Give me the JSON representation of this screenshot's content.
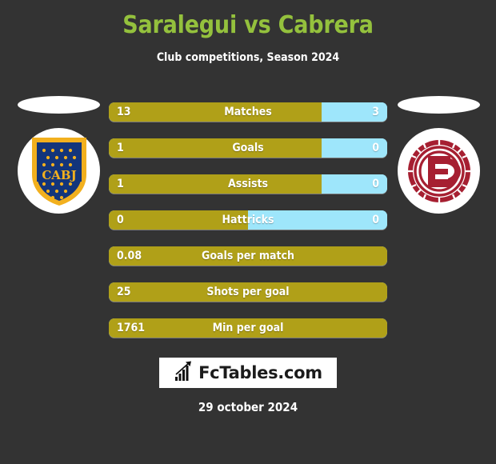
{
  "header": {
    "title": "Saralegui vs Cabrera",
    "subtitle": "Club competitions, Season 2024",
    "title_color": "#94c13d"
  },
  "teams": {
    "home": {
      "crest_name": "boca-juniors-crest",
      "crest_text": "CABJ"
    },
    "away": {
      "crest_name": "lanus-crest",
      "crest_text": ""
    }
  },
  "colors": {
    "background": "#333333",
    "home_bar": "#b0a018",
    "away_bar": "#9ee6fb",
    "accent_green": "#94c13d",
    "text": "#ffffff"
  },
  "chart_data": {
    "type": "bar",
    "title": "Saralegui vs Cabrera",
    "subtitle": "Club competitions, Season 2024",
    "orientation": "horizontal-diverging",
    "series": [
      {
        "name": "Saralegui",
        "color": "#b0a018"
      },
      {
        "name": "Cabrera",
        "color": "#9ee6fb"
      }
    ],
    "categories": [
      "Matches",
      "Goals",
      "Assists",
      "Hattricks",
      "Goals per match",
      "Shots per goal",
      "Min per goal"
    ],
    "rows": [
      {
        "label": "Matches",
        "home": "13",
        "away": "3",
        "home_pct": 76.4,
        "two_sided": true
      },
      {
        "label": "Goals",
        "home": "1",
        "away": "0",
        "home_pct": 76.4,
        "two_sided": true
      },
      {
        "label": "Assists",
        "home": "1",
        "away": "0",
        "home_pct": 76.4,
        "two_sided": true
      },
      {
        "label": "Hattricks",
        "home": "0",
        "away": "0",
        "home_pct": 50.0,
        "two_sided": true
      },
      {
        "label": "Goals per match",
        "home": "0.08",
        "away": "",
        "home_pct": 100,
        "two_sided": false
      },
      {
        "label": "Shots per goal",
        "home": "25",
        "away": "",
        "home_pct": 100,
        "two_sided": false
      },
      {
        "label": "Min per goal",
        "home": "1761",
        "away": "",
        "home_pct": 100,
        "two_sided": false
      }
    ]
  },
  "footer": {
    "brand": "FcTables.com",
    "brand_icon": "bar-chart-up-icon",
    "date": "29 october 2024"
  }
}
